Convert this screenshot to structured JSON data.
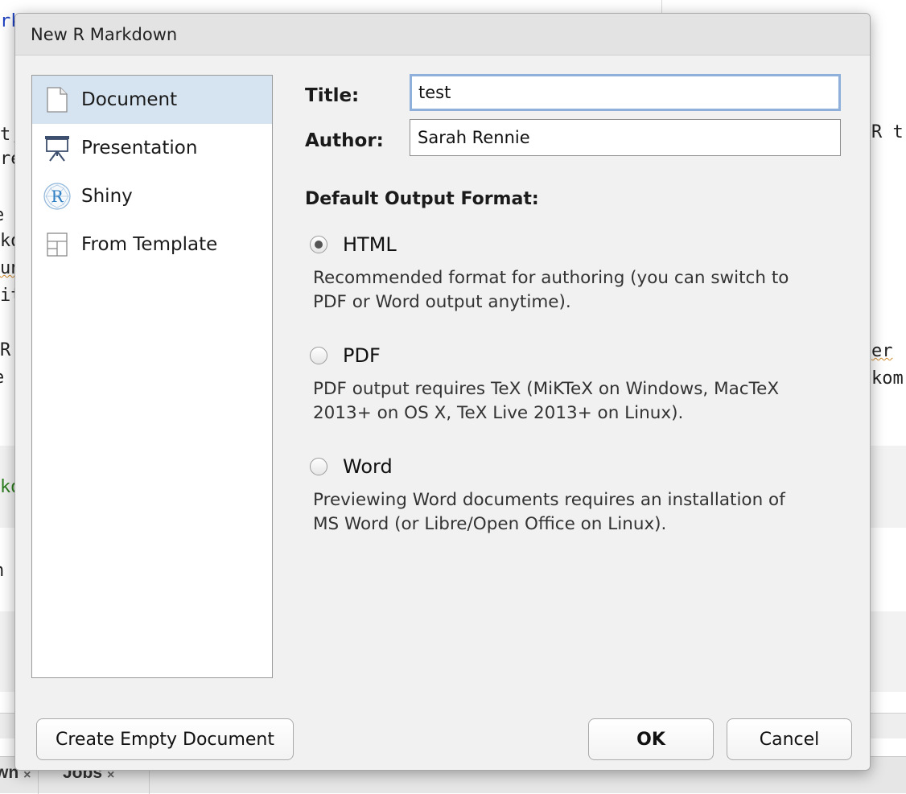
{
  "background": {
    "code_fragments": [
      {
        "text": "rk",
        "cls": "blue"
      },
      {
        "text": "t,",
        "cls": ""
      },
      {
        "text": "re",
        "cls": ""
      },
      {
        "text": "e",
        "cls": ""
      },
      {
        "text": "kd",
        "cls": ""
      },
      {
        "text": "un",
        "cls": "wavy"
      },
      {
        "text": "it",
        "cls": ""
      },
      {
        "text": "R",
        "cls": ""
      },
      {
        "text": "e",
        "cls": ""
      },
      {
        "text": "kd",
        "cls": "green"
      },
      {
        "text": "n",
        "cls": ""
      },
      {
        "text": "R t",
        "cls": ""
      },
      {
        "text": "er",
        "cls": "wavy"
      },
      {
        "text": "kom",
        "cls": ""
      }
    ],
    "tabs": [
      {
        "label": "wn",
        "close": "×"
      },
      {
        "label": "Jobs",
        "close": "×"
      }
    ]
  },
  "dialog": {
    "title": "New R Markdown",
    "templates": [
      {
        "label": "Document",
        "icon": "document-icon",
        "selected": true
      },
      {
        "label": "Presentation",
        "icon": "presentation-icon",
        "selected": false
      },
      {
        "label": "Shiny",
        "icon": "shiny-r-icon",
        "selected": false
      },
      {
        "label": "From Template",
        "icon": "template-icon",
        "selected": false
      }
    ],
    "title_field": {
      "label": "Title:",
      "value": "test"
    },
    "author_field": {
      "label": "Author:",
      "value": "Sarah Rennie"
    },
    "output_section_label": "Default Output Format:",
    "formats": [
      {
        "label": "HTML",
        "checked": true,
        "description_lines": [
          "Recommended format for authoring (you can switch to",
          "PDF or Word output anytime)."
        ]
      },
      {
        "label": "PDF",
        "checked": false,
        "description_lines": [
          "PDF output requires TeX (MiKTeX on Windows, MacTeX",
          "2013+ on OS X, TeX Live 2013+ on Linux)."
        ]
      },
      {
        "label": "Word",
        "checked": false,
        "description_lines": [
          "Previewing Word documents requires an installation of",
          "MS Word (or Libre/Open Office on Linux)."
        ]
      }
    ],
    "buttons": {
      "create_empty": "Create Empty Document",
      "ok": "OK",
      "cancel": "Cancel"
    },
    "colors": {
      "selection": "#d6e4f2",
      "focus_ring": "#8fb0da",
      "shiny_blue": "#2e7fc4"
    }
  }
}
